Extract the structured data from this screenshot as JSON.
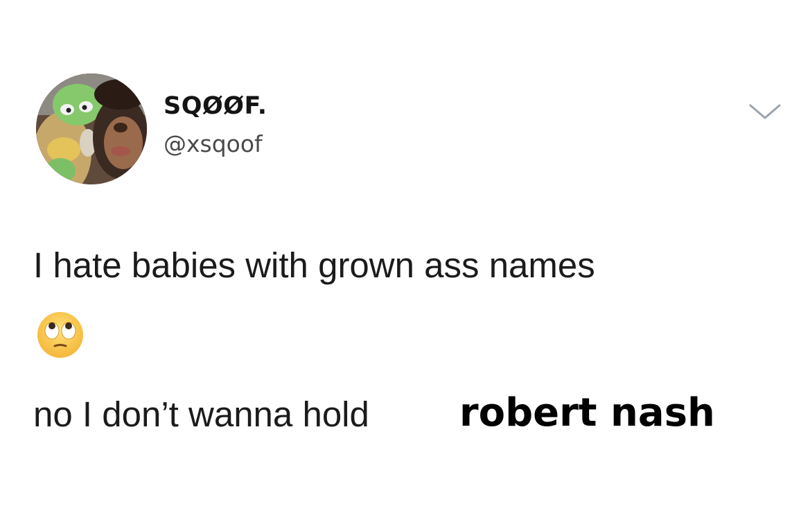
{
  "tweet": {
    "display_name": "SQØØF.",
    "handle": "@xsqoof",
    "text_line_1": "I hate babies with grown ass names",
    "emoji_name": "face-with-rolling-eyes",
    "text_line_2": "no I don’t wanna hold",
    "overlay_text": "robert nash"
  },
  "icons": {
    "menu": "chevron-down-icon",
    "avatar": "avatar-image"
  },
  "colors": {
    "background": "#ffffff",
    "text": "#1b1b1b",
    "handle": "#4a4a4a",
    "chevron": "#9aa3ab"
  }
}
